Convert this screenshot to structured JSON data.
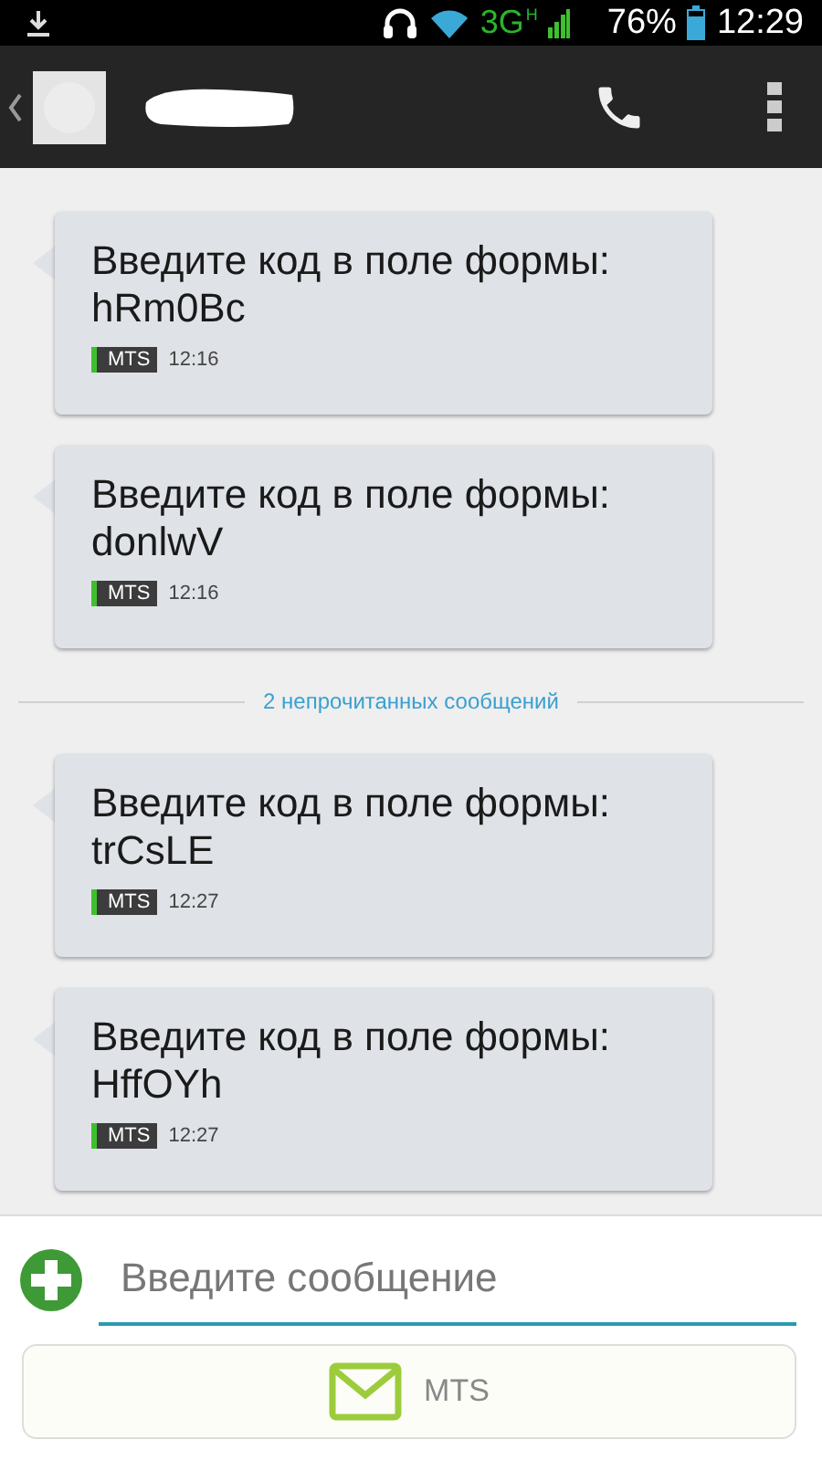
{
  "status_bar": {
    "network": "3G",
    "signal_badge": "H",
    "battery": "76%",
    "time": "12:29"
  },
  "feed": [
    {
      "kind": "message",
      "text": "Введите код в поле формы:\nhRm0Bc",
      "sim": "MTS",
      "time": "12:16"
    },
    {
      "kind": "message",
      "text": "Введите код в поле формы:\ndonlwV",
      "sim": "MTS",
      "time": "12:16"
    },
    {
      "kind": "divider",
      "text": "2 непрочитанных сообщений"
    },
    {
      "kind": "message",
      "text": "Введите код в поле формы:\ntrCsLE",
      "sim": "MTS",
      "time": "12:27"
    },
    {
      "kind": "message",
      "text": "Введите код в поле формы:\nHffOYh",
      "sim": "MTS",
      "time": "12:27"
    }
  ],
  "composer": {
    "placeholder": "Введите сообщение",
    "send_label": "MTS"
  }
}
